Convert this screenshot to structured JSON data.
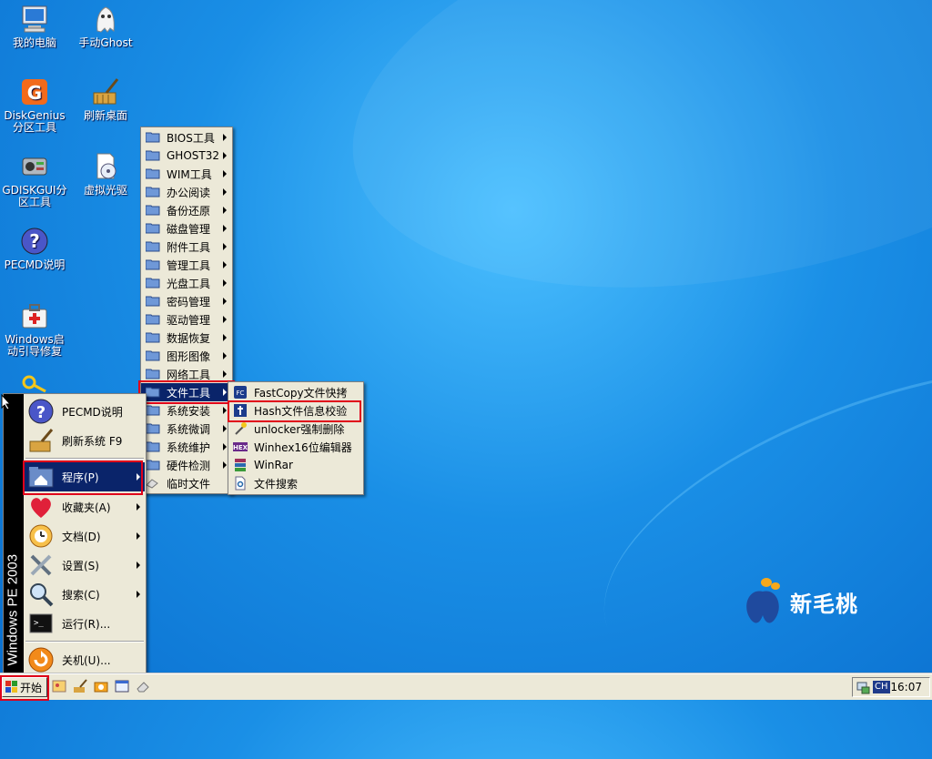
{
  "desktop": {
    "icons": [
      {
        "label": "我的电脑",
        "icon": "computer-icon"
      },
      {
        "label": "手动Ghost",
        "icon": "ghost-icon"
      },
      {
        "label": "DiskGenius分区工具",
        "icon": "diskgenius-icon"
      },
      {
        "label": "刷新桌面",
        "icon": "broom-icon"
      },
      {
        "label": "GDISKGUI分区工具",
        "icon": "gdisk-icon"
      },
      {
        "label": "虚拟光驱",
        "icon": "virtual-drive-icon"
      },
      {
        "label": "PECMD说明",
        "icon": "help-icon"
      },
      {
        "label": "Windows启动引导修复",
        "icon": "repair-kit-icon"
      }
    ],
    "brand": "新毛桃"
  },
  "programs_menu": {
    "items": [
      {
        "label": "BIOS工具",
        "submenu": true
      },
      {
        "label": "GHOST32",
        "submenu": true
      },
      {
        "label": "WIM工具",
        "submenu": true
      },
      {
        "label": "办公阅读",
        "submenu": true
      },
      {
        "label": "备份还原",
        "submenu": true
      },
      {
        "label": "磁盘管理",
        "submenu": true
      },
      {
        "label": "附件工具",
        "submenu": true
      },
      {
        "label": "管理工具",
        "submenu": true
      },
      {
        "label": "光盘工具",
        "submenu": true
      },
      {
        "label": "密码管理",
        "submenu": true
      },
      {
        "label": "驱动管理",
        "submenu": true
      },
      {
        "label": "数据恢复",
        "submenu": true
      },
      {
        "label": "图形图像",
        "submenu": true
      },
      {
        "label": "网络工具",
        "submenu": true
      },
      {
        "label": "文件工具",
        "submenu": true,
        "selected": true
      },
      {
        "label": "系统安装",
        "submenu": true
      },
      {
        "label": "系统微调",
        "submenu": true
      },
      {
        "label": "系统维护",
        "submenu": true
      },
      {
        "label": "硬件检测",
        "submenu": true
      },
      {
        "label": "临时文件",
        "submenu": false
      }
    ]
  },
  "file_tools_menu": {
    "items": [
      {
        "label": "FastCopy文件快拷"
      },
      {
        "label": "Hash文件信息校验"
      },
      {
        "label": "unlocker强制删除"
      },
      {
        "label": "Winhex16位编辑器"
      },
      {
        "label": "WinRar"
      },
      {
        "label": "文件搜索"
      }
    ]
  },
  "start_menu": {
    "sidebar_text": "Windows PE 2003",
    "items": [
      {
        "label": "PECMD说明"
      },
      {
        "label": "刷新系统 F9"
      },
      {
        "label": "程序(P)",
        "selected": true
      },
      {
        "label": "收藏夹(A)"
      },
      {
        "label": "文档(D)"
      },
      {
        "label": "设置(S)"
      },
      {
        "label": "搜索(C)"
      },
      {
        "label": "运行(R)..."
      },
      {
        "label": "关机(U)..."
      }
    ]
  },
  "taskbar": {
    "start_label": "开始",
    "tray_lang": "CH",
    "clock": "16:07"
  },
  "colors": {
    "selection": "#0a246a",
    "highlight_box": "#e0001a",
    "menu_bg": "#ece9d8"
  }
}
